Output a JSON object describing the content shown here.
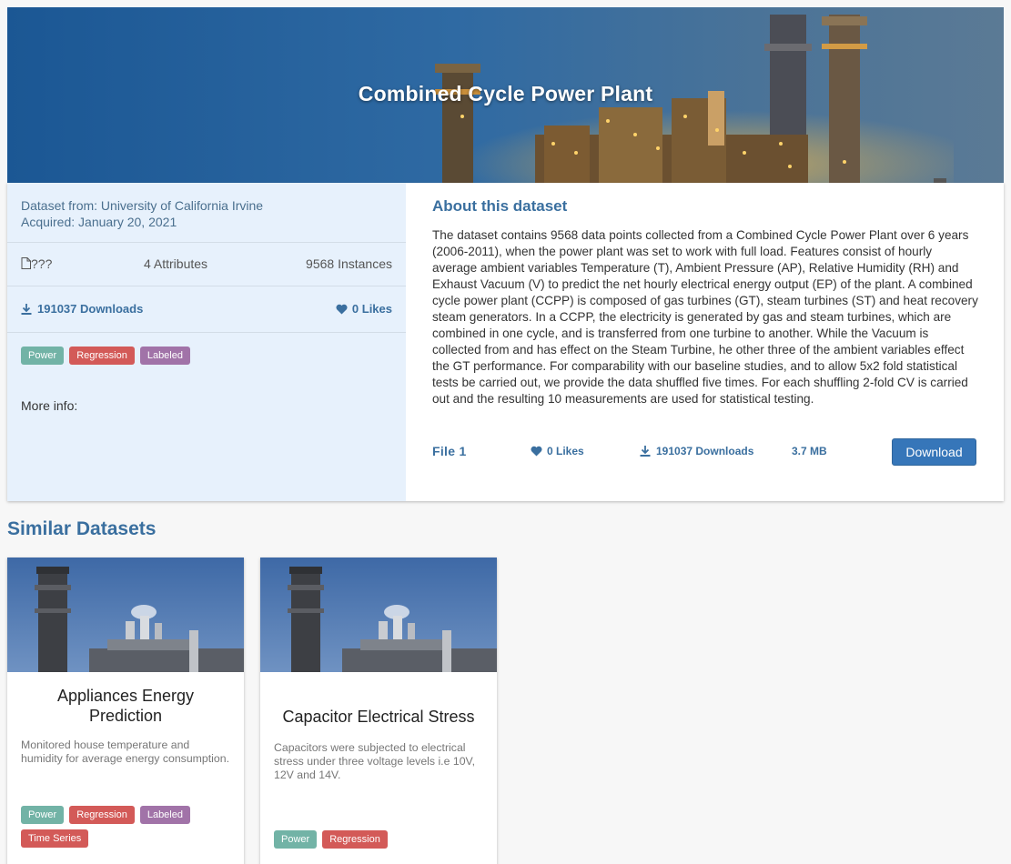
{
  "hero": {
    "title": "Combined Cycle Power Plant"
  },
  "source": {
    "from": "Dataset from: University of California Irvine",
    "acquired": "Acquired: January 20, 2021"
  },
  "stats": {
    "doc": "???",
    "attributes": "4 Attributes",
    "instances": "9568 Instances"
  },
  "engagement": {
    "downloads": "191037 Downloads",
    "likes": "0 Likes"
  },
  "tags": [
    {
      "label": "Power",
      "color": "#72b3a6"
    },
    {
      "label": "Regression",
      "color": "#d35a58"
    },
    {
      "label": "Labeled",
      "color": "#a173a8"
    }
  ],
  "more_info": "More info:",
  "about": {
    "title": "About this dataset",
    "text": "The dataset contains 9568 data points collected from a Combined Cycle Power Plant over 6 years (2006-2011), when the power plant was set to work with full load. Features consist of hourly average ambient variables Temperature (T), Ambient Pressure (AP), Relative Humidity (RH) and Exhaust Vacuum (V) to predict the net hourly electrical energy output (EP) of the plant. A combined cycle power plant (CCPP) is composed of gas turbines (GT), steam turbines (ST) and heat recovery steam generators. In a CCPP, the electricity is generated by gas and steam turbines, which are combined in one cycle, and is transferred from one turbine to another. While the Vacuum is collected from and has effect on the Steam Turbine, he other three of the ambient variables effect the GT performance. For comparability with our baseline studies, and to allow 5x2 fold statistical tests be carried out, we provide the data shuffled five times. For each shuffling 2-fold CV is carried out and the resulting 10 measurements are used for statistical testing."
  },
  "file": {
    "name": "File 1",
    "likes": "0 Likes",
    "downloads": "191037 Downloads",
    "size": "3.7 MB",
    "download_label": "Download"
  },
  "similar": {
    "title": "Similar Datasets",
    "cards": [
      {
        "title": "Appliances Energy Prediction",
        "description": "Monitored house temperature and humidity for average energy consumption.",
        "tags": [
          {
            "label": "Power",
            "color": "#72b3a6"
          },
          {
            "label": "Regression",
            "color": "#d35a58"
          },
          {
            "label": "Labeled",
            "color": "#a173a8"
          },
          {
            "label": "Time Series",
            "color": "#d35a58"
          }
        ]
      },
      {
        "title": "Capacitor Electrical Stress",
        "description": "Capacitors were subjected to electrical stress under three voltage levels i.e 10V, 12V and 14V.",
        "tags": [
          {
            "label": "Power",
            "color": "#72b3a6"
          },
          {
            "label": "Regression",
            "color": "#d35a58"
          }
        ]
      }
    ]
  },
  "colors": {
    "accent": "#3a6f9f",
    "button": "#3676b9",
    "left_panel": "#e7f1fc"
  }
}
